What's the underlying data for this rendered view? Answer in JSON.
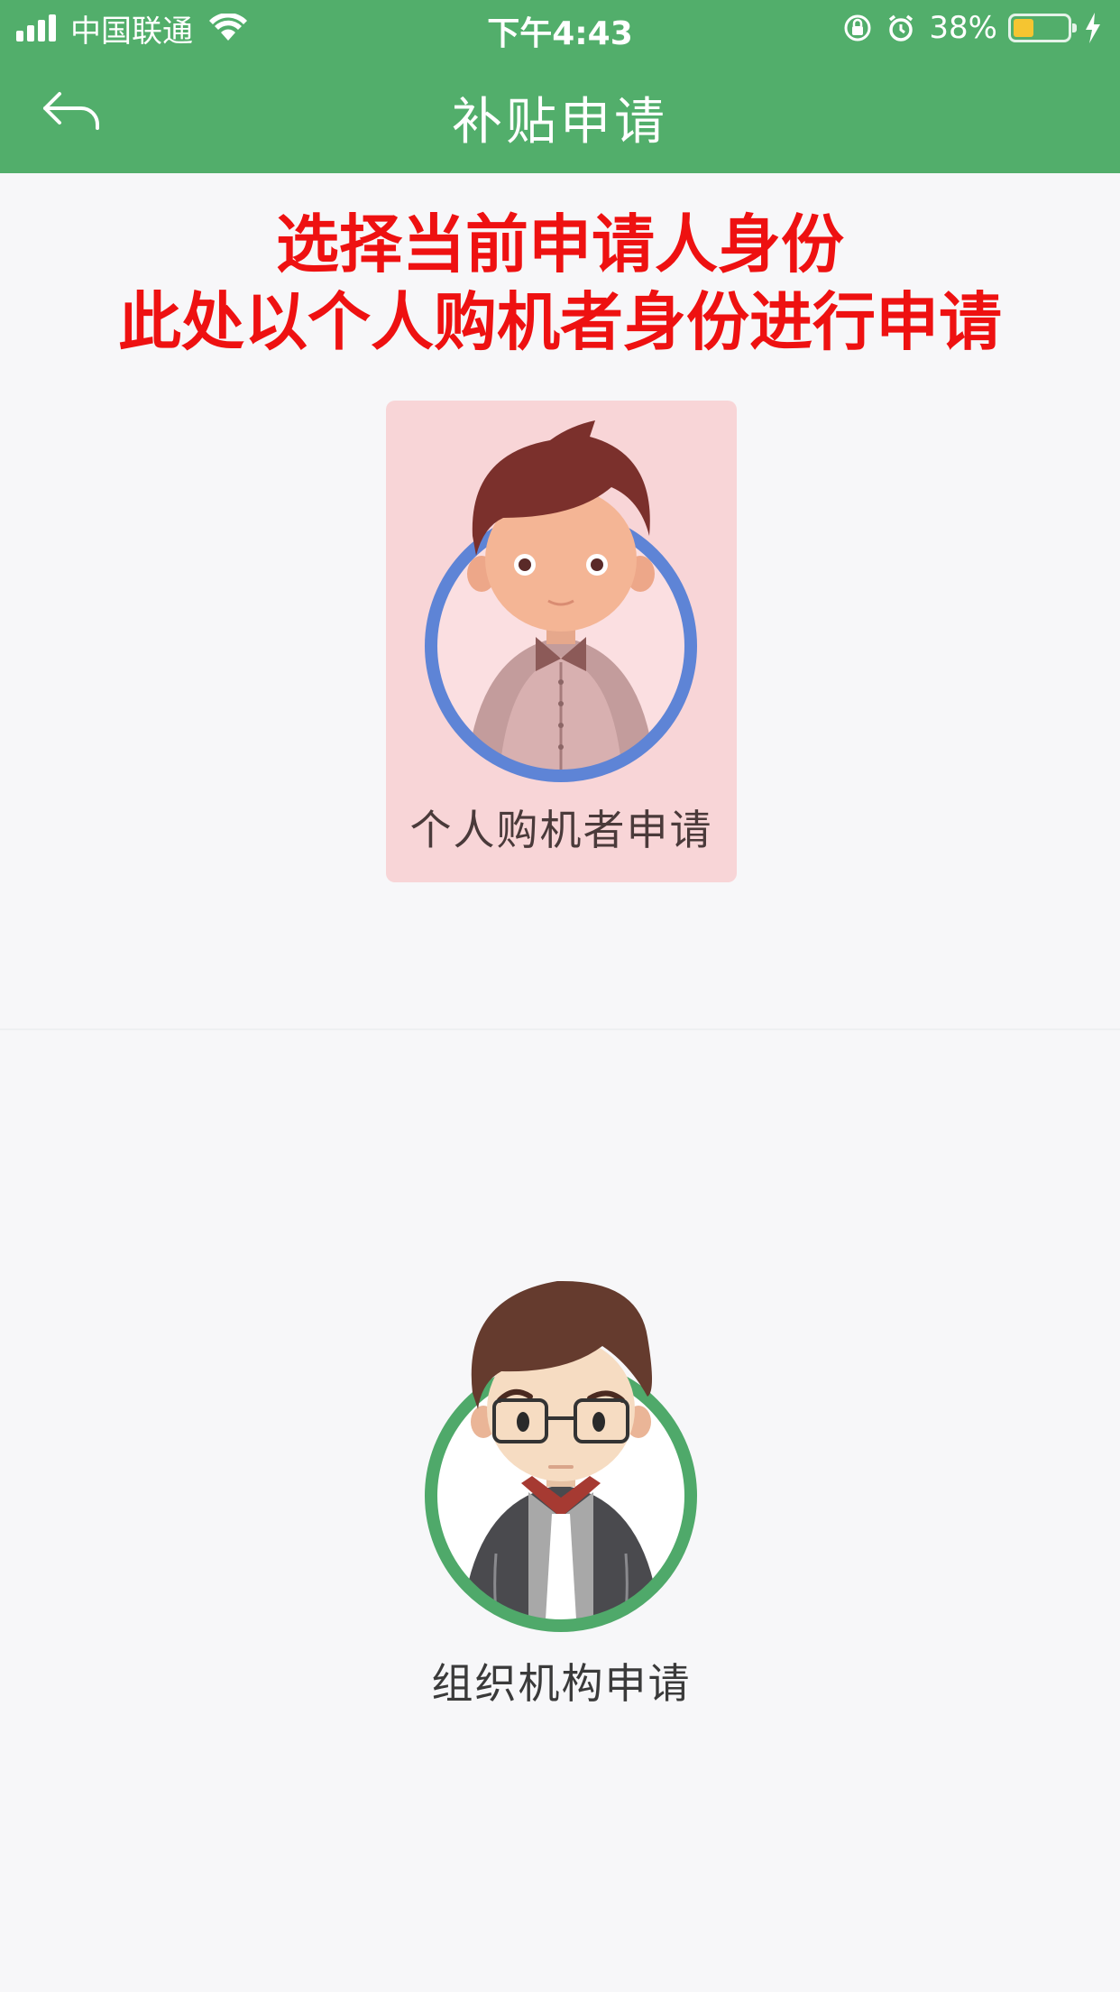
{
  "status_bar": {
    "carrier": "中国联通",
    "time": "下午4:43",
    "battery_percent": "38%",
    "battery_level": 0.38,
    "icons": [
      "signal-icon",
      "wifi-icon",
      "orientation-lock-icon",
      "alarm-icon",
      "battery-icon",
      "charging-icon"
    ]
  },
  "nav": {
    "title": "补贴申请",
    "back_icon": "back-arrow-icon"
  },
  "instruction": {
    "line1": "选择当前申请人身份",
    "line2": "此处以个人购机者身份进行申请"
  },
  "options": [
    {
      "label": "个人购机者申请",
      "selected": true,
      "ring_color": "#5e84d6",
      "card_color": "#f8d5d7"
    },
    {
      "label": "组织机构申请",
      "selected": false,
      "ring_color": "#4fa96a"
    }
  ],
  "colors": {
    "header": "#52ae6b",
    "instruction": "#ee1111",
    "background": "#f7f7f9"
  }
}
